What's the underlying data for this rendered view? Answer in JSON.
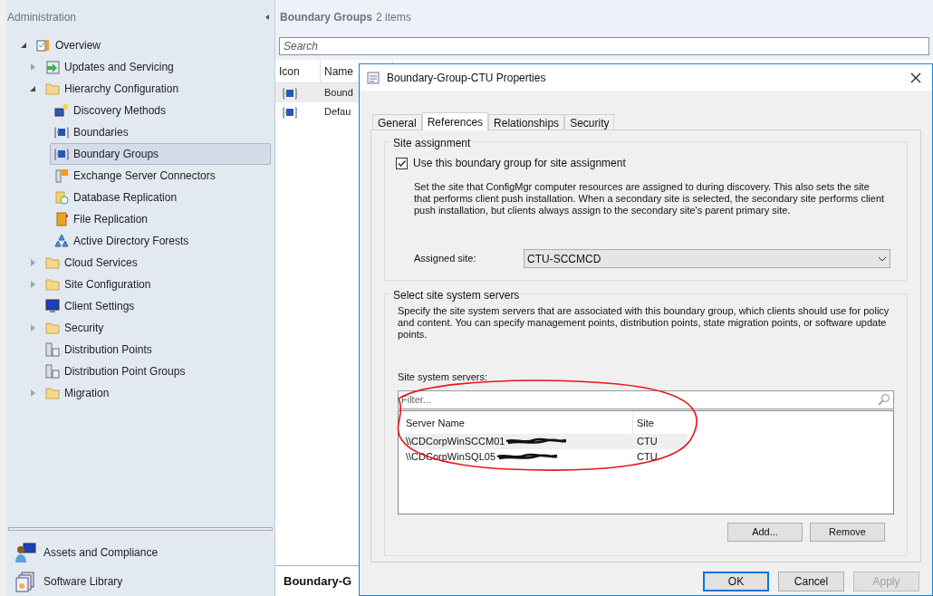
{
  "navigation": {
    "title": "Administration",
    "tree": [
      {
        "label": "Overview",
        "kind": "overview",
        "expanded": true,
        "selected": false,
        "children": [
          {
            "label": "Updates and Servicing",
            "kind": "updates",
            "expanded": false,
            "selected": false
          },
          {
            "label": "Hierarchy Configuration",
            "kind": "folder",
            "expanded": true,
            "selected": false,
            "children": [
              {
                "label": "Discovery Methods",
                "kind": "discovery",
                "selected": false
              },
              {
                "label": "Boundaries",
                "kind": "boundary",
                "selected": false
              },
              {
                "label": "Boundary Groups",
                "kind": "boundary",
                "selected": true
              },
              {
                "label": "Exchange Server Connectors",
                "kind": "exchange",
                "selected": false
              },
              {
                "label": "Database Replication",
                "kind": "database",
                "selected": false
              },
              {
                "label": "File Replication",
                "kind": "file",
                "selected": false
              },
              {
                "label": "Active Directory Forests",
                "kind": "forest",
                "selected": false
              }
            ]
          },
          {
            "label": "Cloud Services",
            "kind": "folder",
            "expanded": false,
            "selected": false
          },
          {
            "label": "Site Configuration",
            "kind": "folder",
            "expanded": false,
            "selected": false
          },
          {
            "label": "Client Settings",
            "kind": "monitor",
            "selected": false
          },
          {
            "label": "Security",
            "kind": "folder",
            "expanded": false,
            "selected": false
          },
          {
            "label": "Distribution Points",
            "kind": "server",
            "selected": false
          },
          {
            "label": "Distribution Point Groups",
            "kind": "server",
            "selected": false
          },
          {
            "label": "Migration",
            "kind": "folder",
            "expanded": false,
            "selected": false
          }
        ]
      }
    ],
    "workspaces": [
      {
        "label": "Assets and Compliance",
        "kind": "person"
      },
      {
        "label": "Software Library",
        "kind": "library"
      }
    ]
  },
  "list": {
    "title": "Boundary Groups",
    "count": "2 items",
    "search": {
      "placeholder": "Search"
    },
    "columns": [
      "Icon",
      "Name"
    ],
    "rows": [
      {
        "name": "Bound",
        "selected": true
      },
      {
        "name": "Defau",
        "selected": false
      }
    ],
    "details_title": "Boundary-G"
  },
  "dialog": {
    "title": "Boundary-Group-CTU Properties",
    "tabs": [
      {
        "label": "General",
        "selected": false
      },
      {
        "label": "References",
        "selected": true
      },
      {
        "label": "Relationships",
        "selected": false
      },
      {
        "label": "Security",
        "selected": false
      }
    ],
    "site_assignment": {
      "title": "Site assignment",
      "checkbox": {
        "label": "Use this boundary group for site assignment",
        "checked": true
      },
      "description": "Set the site that ConfigMgr computer resources are assigned to during discovery. This also sets the site that performs client push installation. When a secondary site is selected, the secondary site performs client push installation, but clients always assign to the secondary site's parent primary site.",
      "assigned_label": "Assigned site:",
      "assigned_value": "CTU-SCCMCD"
    },
    "servers": {
      "title": "Select site system servers",
      "description": "Specify the site system servers that are associated with this boundary group, which clients should use for policy and content. You can specify management points, distribution points, state migration points, or software update points.",
      "list_label": "Site system servers:",
      "filter": {
        "placeholder": "Filter..."
      },
      "columns": [
        "Server Name",
        "Site"
      ],
      "rows": [
        {
          "server": "\\\\CDCorpWinSCCM01",
          "site": "CTU",
          "selected": true
        },
        {
          "server": "\\\\CDCorpWinSQL05",
          "site": "CTU",
          "selected": false
        }
      ],
      "buttons": [
        "Add...",
        "Remove"
      ]
    },
    "buttons": [
      {
        "label": "OK",
        "kind": "default",
        "disabled": false
      },
      {
        "label": "Cancel",
        "kind": "normal",
        "disabled": false
      },
      {
        "label": "Apply",
        "kind": "normal",
        "disabled": true
      }
    ]
  }
}
